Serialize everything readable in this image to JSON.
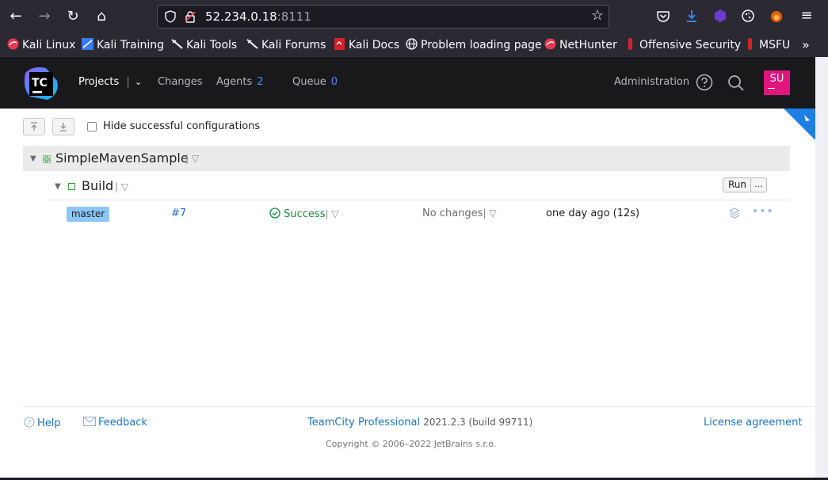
{
  "browser": {
    "url_host": "52.234.0.18",
    "url_port": ":8111",
    "bookmarks": [
      {
        "label": "Kali Linux"
      },
      {
        "label": "Kali Training"
      },
      {
        "label": "Kali Tools"
      },
      {
        "label": "Kali Forums"
      },
      {
        "label": "Kali Docs"
      },
      {
        "label": "Problem loading page"
      },
      {
        "label": "NetHunter"
      },
      {
        "label": "Offensive Security"
      },
      {
        "label": "MSFU"
      }
    ]
  },
  "header": {
    "logo_text": "TC",
    "projects_label": "Projects",
    "changes_label": "Changes",
    "agents_label": "Agents",
    "agents_count": "2",
    "queue_label": "Queue",
    "queue_count": "0",
    "administration_label": "Administration",
    "avatar_initials": "SU"
  },
  "toolbar": {
    "hide_successful_label": "Hide successful configurations"
  },
  "project": {
    "name": "SimpleMavenSample",
    "build": {
      "name": "Build",
      "run_label": "Run",
      "more_label": "...",
      "branch": "master",
      "number": "#7",
      "status": "Success",
      "changes": "No changes",
      "time": "one day ago (12s)"
    }
  },
  "footer": {
    "help_label": "Help",
    "feedback_label": "Feedback",
    "product_label": "TeamCity Professional",
    "version": "2021.2.3 (build 99711)",
    "license_label": "License agreement",
    "copyright": "Copyright © 2006–2022 JetBrains s.r.o."
  },
  "colors": {
    "accent": "#1a73c2",
    "success": "#1b8a3f",
    "avatar": "#e0157d"
  }
}
